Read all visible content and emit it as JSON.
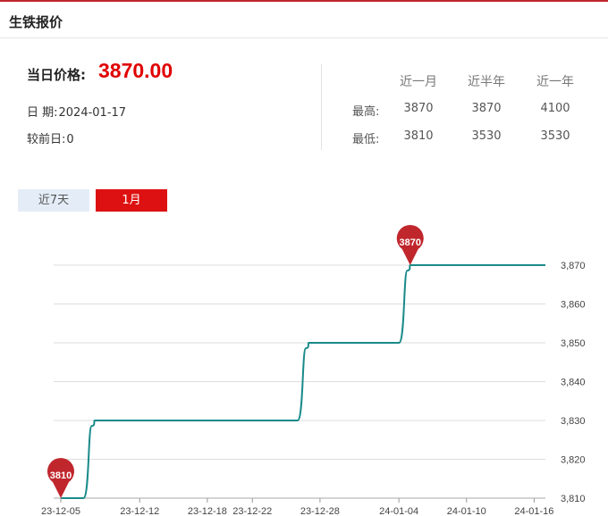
{
  "header": {
    "title": "生铁报价"
  },
  "summary": {
    "price_label": "当日价格:",
    "price": "3870.00",
    "date_label": "日 期:",
    "date": "2024-01-17",
    "change_label": "较前日:",
    "change": "0"
  },
  "stats": {
    "columns": [
      "近一月",
      "近半年",
      "近一年"
    ],
    "rows": [
      {
        "label": "最高:",
        "values": [
          "3870",
          "3870",
          "4100"
        ]
      },
      {
        "label": "最低:",
        "values": [
          "3810",
          "3530",
          "3530"
        ]
      }
    ]
  },
  "tabs": [
    {
      "label": "近7天",
      "active": false
    },
    {
      "label": "1月",
      "active": true
    }
  ],
  "colors": {
    "accent": "#dd1111",
    "line": "#1a8a8a",
    "marker": "#c0272d"
  },
  "chart_data": {
    "type": "line",
    "x": [
      "23-12-05",
      "23-12-07",
      "23-12-08",
      "23-12-21",
      "23-12-26",
      "23-12-27",
      "24-01-03",
      "24-01-04",
      "24-01-05",
      "24-01-17"
    ],
    "series": [
      {
        "values": [
          3810,
          3810,
          3830,
          3830,
          3830,
          3850,
          3850,
          3850,
          3870,
          3870
        ]
      }
    ],
    "x_ticks": [
      "23-12-05",
      "23-12-12",
      "23-12-18",
      "23-12-22",
      "23-12-28",
      "24-01-04",
      "24-01-10",
      "24-01-16"
    ],
    "y_ticks": [
      "3,810",
      "3,820",
      "3,830",
      "3,840",
      "3,850",
      "3,860",
      "3,870"
    ],
    "ylim": [
      3810,
      3870
    ],
    "grid": true,
    "markers": [
      {
        "label": "3810",
        "x": "23-12-05",
        "value": 3810
      },
      {
        "label": "3870",
        "x": "24-01-05",
        "value": 3870
      }
    ]
  }
}
